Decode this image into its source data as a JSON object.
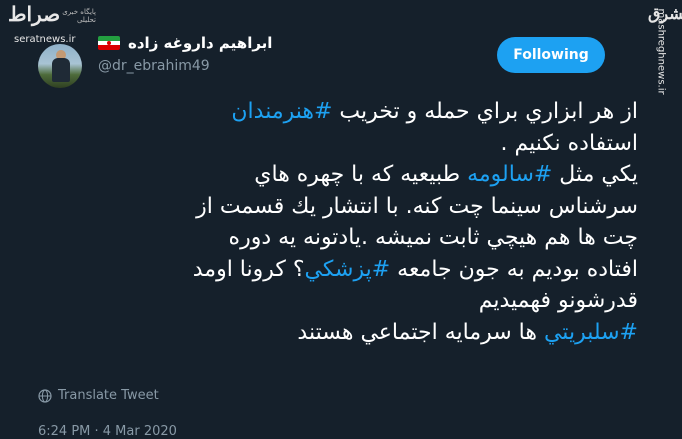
{
  "watermarks": {
    "left_logo": "صراط",
    "left_subtitle": "پایگاه خبری تحلیلی",
    "left_url": "seratnews.ir",
    "right_logo": "مشرق",
    "right_url": "mashreghnews.ir"
  },
  "author": {
    "display_name": "ابراهیم داروغه زاده",
    "handle": "@dr_ebrahim49"
  },
  "follow_button": {
    "label": "Following"
  },
  "tweet": {
    "lines": [
      [
        {
          "t": "از هر ابزاري براي حمله و تخريب ",
          "h": false
        },
        {
          "t": "#هنرمندان",
          "h": true
        }
      ],
      [
        {
          "t": "استفاده نكنيم .",
          "h": false
        }
      ],
      [
        {
          "t": "يكي مثل ",
          "h": false
        },
        {
          "t": "#سالومه",
          "h": true
        },
        {
          "t": " طبيعيه كه با چهره هاي",
          "h": false
        }
      ],
      [
        {
          "t": "سرشناس سينما چت كنه. با انتشار يك قسمت از",
          "h": false
        }
      ],
      [
        {
          "t": "چت ها هم هيچي ثابت نميشه .يادتونه يه دوره",
          "h": false
        }
      ],
      [
        {
          "t": "افتاده بوديم به جون جامعه ",
          "h": false
        },
        {
          "t": "#پزشكي",
          "h": true
        },
        {
          "t": "؟ كرونا اومد",
          "h": false
        }
      ],
      [
        {
          "t": "قدرشونو فهميديم",
          "h": false
        }
      ],
      [
        {
          "t": "#سلبريتي",
          "h": true
        },
        {
          "t": " ها سرمايه اجتماعي هستند",
          "h": false
        }
      ]
    ]
  },
  "translate": {
    "label": "Translate Tweet",
    "icon": "globe-icon"
  },
  "timestamp": "6:24 PM · 4 Mar 2020",
  "colors": {
    "background": "#15202b",
    "accent": "#1da1f2",
    "muted": "#8899a6"
  }
}
